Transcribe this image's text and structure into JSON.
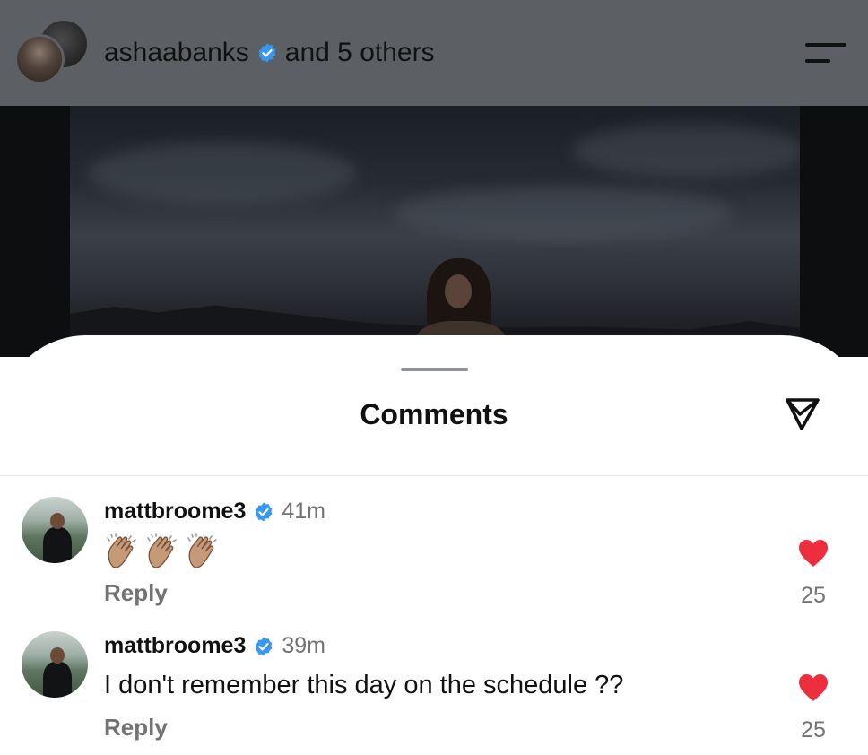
{
  "header": {
    "username": "ashaabanks",
    "suffix": "and 5 others"
  },
  "sheet": {
    "title": "Comments"
  },
  "comments": [
    {
      "username": "mattbroome3",
      "time": "41m",
      "text": "👏🏽👏🏽👏🏽",
      "reply_label": "Reply",
      "likes": "25"
    },
    {
      "username": "mattbroome3",
      "time": "39m",
      "text": "I don't remember this day on the schedule ??",
      "reply_label": "Reply",
      "likes": "25"
    }
  ],
  "colors": {
    "verified": "#3897f0",
    "heart": "#ed2e3c",
    "header_bg": "#5c5f63"
  },
  "icons": [
    "verified-badge-icon",
    "menu-icon",
    "share-icon",
    "heart-icon",
    "clap-emoji-icon"
  ]
}
